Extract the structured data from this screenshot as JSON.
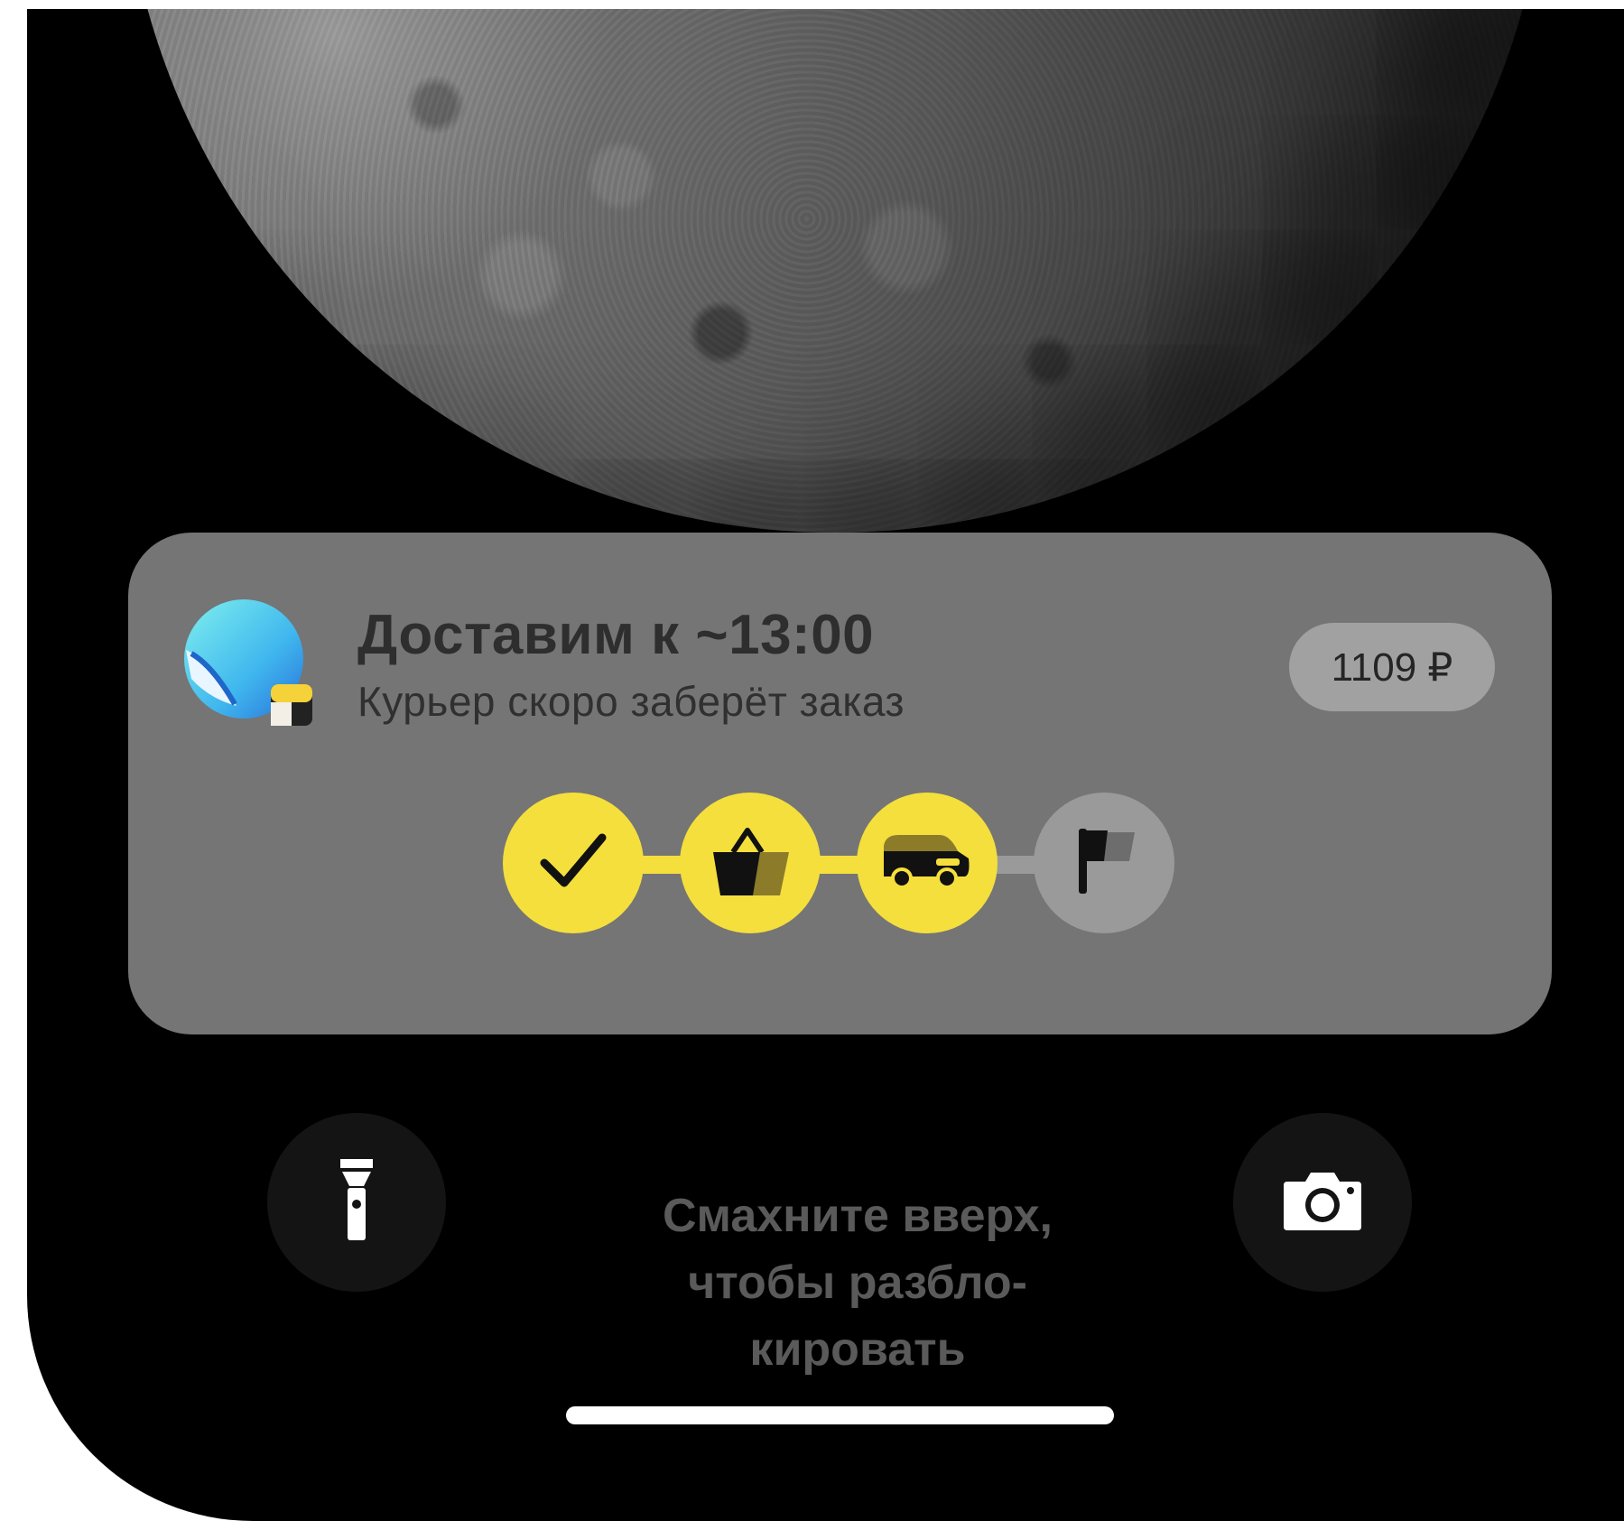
{
  "notification": {
    "title": "Доставим к ~13:00",
    "subtitle": "Курьер скоро заберёт заказ",
    "price": "1109 ₽",
    "app_icon": "delivery-app-icon"
  },
  "progress": {
    "steps": [
      {
        "name": "order-confirmed",
        "icon": "checkmark-icon",
        "state": "done"
      },
      {
        "name": "assembling",
        "icon": "basket-icon",
        "state": "done"
      },
      {
        "name": "in-transit",
        "icon": "delivery-car-icon",
        "state": "current"
      },
      {
        "name": "delivered",
        "icon": "flag-icon",
        "state": "pending"
      }
    ],
    "colors": {
      "done": "#f5df3c",
      "pending": "#9a9a9a",
      "line_done": "#f5df3c",
      "line_pending": "#9a9a9a"
    }
  },
  "lockscreen": {
    "hint_line1": "Смахните вверх,",
    "hint_line2": "чтобы разбло-",
    "hint_line3": "кировать",
    "left_button_icon": "flashlight-icon",
    "right_button_icon": "camera-icon"
  }
}
